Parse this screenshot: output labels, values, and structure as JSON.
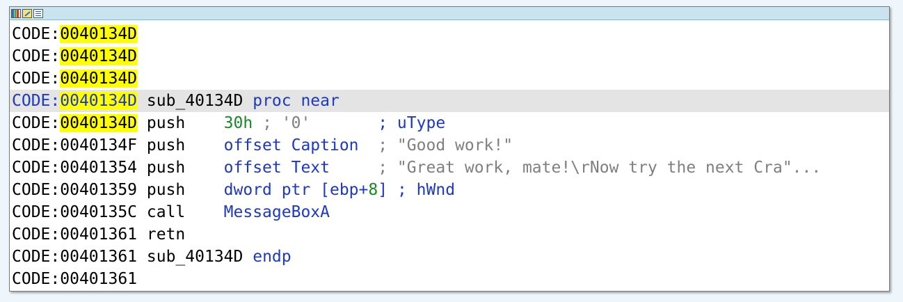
{
  "titlebar": {
    "icons": [
      "graph-icon",
      "edit-icon",
      "listing-icon"
    ]
  },
  "lines": [
    {
      "seg": "CODE:",
      "addr": "0040134D",
      "hl": true
    },
    {
      "seg": "CODE:",
      "addr": "0040134D",
      "hl": true
    },
    {
      "seg": "CODE:",
      "addr": "0040134D",
      "hl": true
    },
    {
      "seg": "CODE:",
      "addr": "0040134D",
      "hl": true,
      "current": true,
      "parts": [
        {
          "t": "sub_40134D",
          "c": "black"
        },
        {
          "t": " proc near",
          "c": "blue"
        }
      ]
    },
    {
      "seg": "CODE:",
      "addr": "0040134D",
      "hl": true,
      "parts": [
        {
          "t": "push",
          "c": "black"
        },
        {
          "t": "    ",
          "c": "black"
        },
        {
          "t": "30h",
          "c": "green"
        },
        {
          "t": " ; '0'",
          "c": "gray"
        },
        {
          "t": "       ; uType",
          "c": "blue"
        }
      ]
    },
    {
      "seg": "CODE:",
      "addr": "0040134F",
      "parts": [
        {
          "t": "push",
          "c": "black"
        },
        {
          "t": "    ",
          "c": "black"
        },
        {
          "t": "offset Caption",
          "c": "blue"
        },
        {
          "t": "  ; \"Good work!\"",
          "c": "gray"
        }
      ]
    },
    {
      "seg": "CODE:",
      "addr": "00401354",
      "parts": [
        {
          "t": "push",
          "c": "black"
        },
        {
          "t": "    ",
          "c": "black"
        },
        {
          "t": "offset Text",
          "c": "blue"
        },
        {
          "t": "     ; \"Great work, mate!\\rNow try the next Cra\"...",
          "c": "gray"
        }
      ]
    },
    {
      "seg": "CODE:",
      "addr": "00401359",
      "parts": [
        {
          "t": "push",
          "c": "black"
        },
        {
          "t": "    ",
          "c": "black"
        },
        {
          "t": "dword ptr [ebp+",
          "c": "blue"
        },
        {
          "t": "8",
          "c": "green"
        },
        {
          "t": "]",
          "c": "blue"
        },
        {
          "t": " ; hWnd",
          "c": "blue"
        }
      ]
    },
    {
      "seg": "CODE:",
      "addr": "0040135C",
      "parts": [
        {
          "t": "call",
          "c": "black"
        },
        {
          "t": "    ",
          "c": "black"
        },
        {
          "t": "MessageBoxA",
          "c": "blue"
        }
      ]
    },
    {
      "seg": "CODE:",
      "addr": "00401361",
      "parts": [
        {
          "t": "retn",
          "c": "black"
        }
      ]
    },
    {
      "seg": "CODE:",
      "addr": "00401361",
      "parts": [
        {
          "t": "sub_40134D",
          "c": "black"
        },
        {
          "t": " endp",
          "c": "blue"
        }
      ]
    },
    {
      "seg": "CODE:",
      "addr": "00401361"
    }
  ]
}
